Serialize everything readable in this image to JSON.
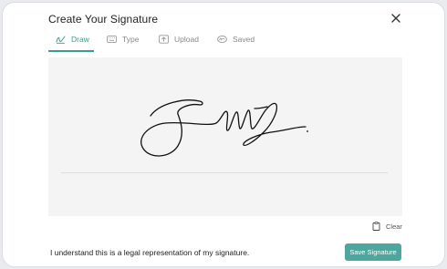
{
  "modal": {
    "title": "Create Your Signature"
  },
  "tabs": [
    {
      "label": "Draw",
      "icon": "pen-signature-icon",
      "active": true
    },
    {
      "label": "Type",
      "icon": "keyboard-icon",
      "active": false
    },
    {
      "label": "Upload",
      "icon": "upload-icon",
      "active": false
    },
    {
      "label": "Saved",
      "icon": "signature-saved-icon",
      "active": false
    }
  ],
  "actions": {
    "clear_label": "Clear",
    "save_label": "Save Signature"
  },
  "footer": {
    "disclaimer": "I understand this is a legal representation of my signature."
  },
  "colors": {
    "accent": "#3a9b93",
    "save_button": "#4ea79f",
    "canvas_bg": "#f4f4f5"
  }
}
